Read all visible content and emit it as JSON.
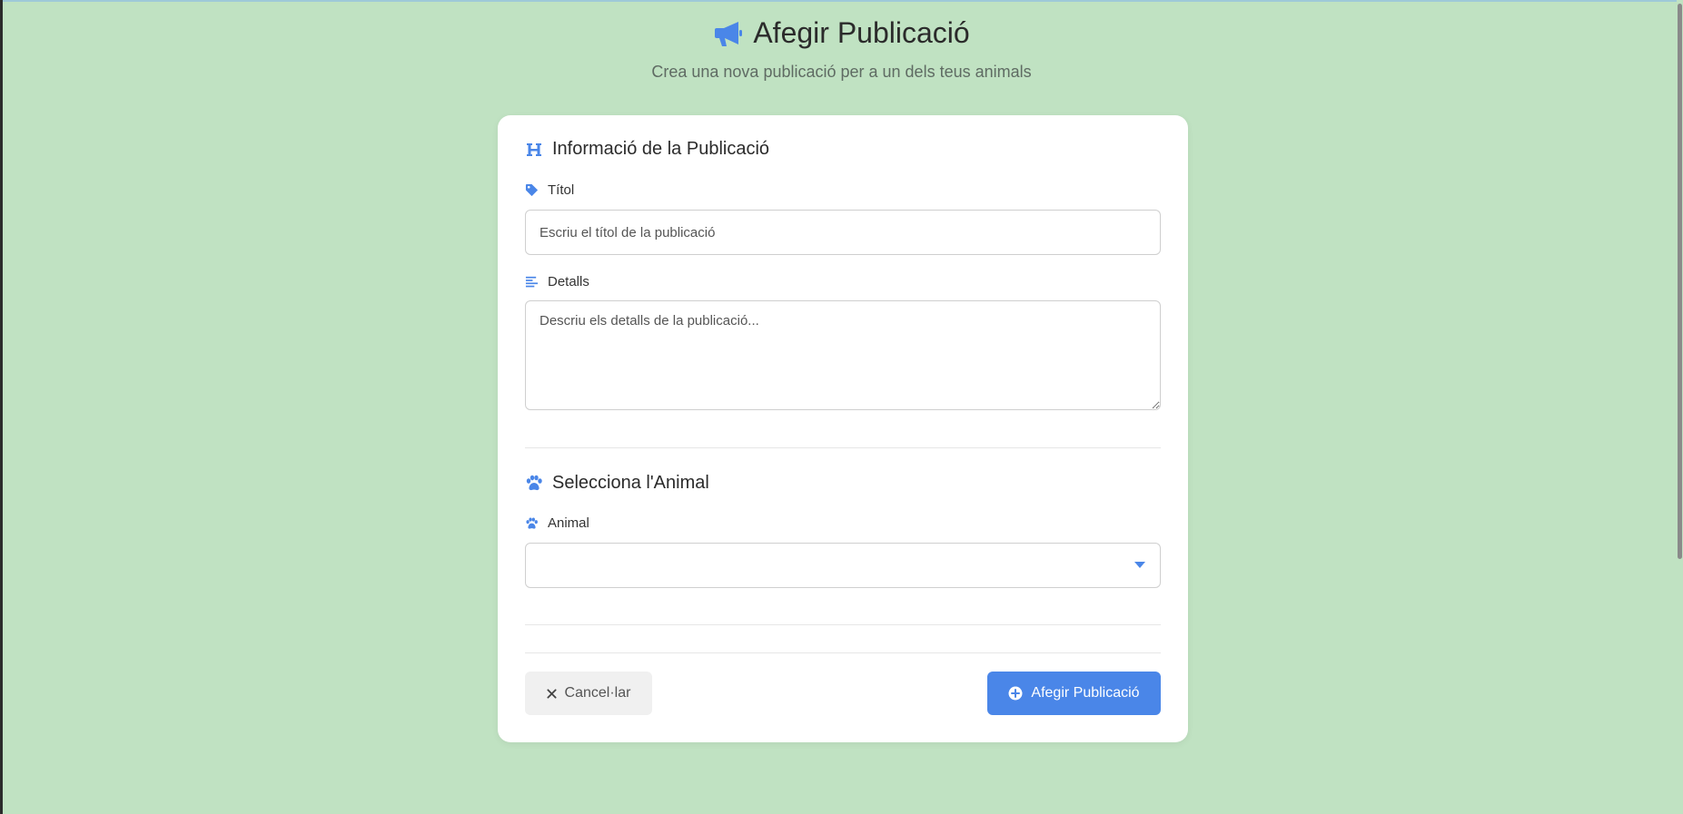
{
  "header": {
    "title": "Afegir Publicació",
    "subtitle": "Crea una nova publicació per a un dels teus animals",
    "icon": "megaphone-icon"
  },
  "form": {
    "info_section": {
      "title": "Informació de la Publicació",
      "icon": "heading-icon"
    },
    "title_field": {
      "label": "Títol",
      "icon": "tag-icon",
      "value": "",
      "placeholder": "Escriu el títol de la publicació"
    },
    "details_field": {
      "label": "Detalls",
      "icon": "align-left-icon",
      "value": "",
      "placeholder": "Descriu els detalls de la publicació..."
    },
    "animal_section": {
      "title": "Selecciona l'Animal",
      "icon": "paw-icon"
    },
    "animal_field": {
      "label": "Animal",
      "icon": "paw-icon",
      "selected": ""
    }
  },
  "actions": {
    "cancel_label": "Cancel·lar",
    "submit_label": "Afegir Publicació"
  },
  "colors": {
    "background": "#c0e2c2",
    "accent": "#4a86e8",
    "card": "#ffffff"
  }
}
